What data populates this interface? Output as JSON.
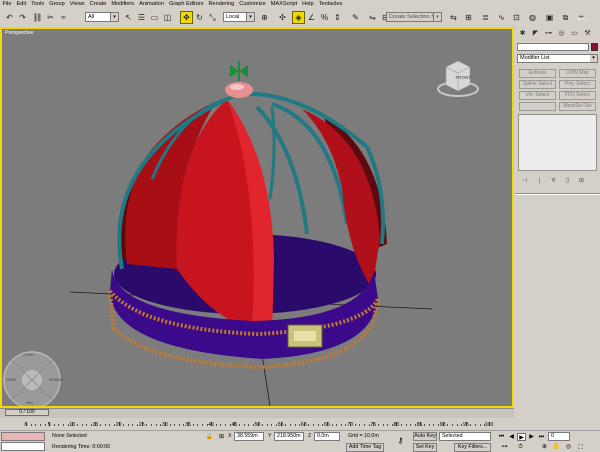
{
  "menu": [
    "File",
    "Edit",
    "Tools",
    "Group",
    "Views",
    "Create",
    "Modifiers",
    "Animation",
    "Graph Editors",
    "Rendering",
    "Customize",
    "MAXScript",
    "Help",
    "Tentacles"
  ],
  "toolbar": {
    "selection_filter": "All",
    "coord_system": "Local",
    "named_selection_placeholder": "Create Selection Set"
  },
  "viewport": {
    "label": "Perspective",
    "viewcube_label": "FRONT",
    "steering_wheel_labels": [
      "ZOOM",
      "ORBIT",
      "PAN",
      "REWIND",
      "CENTER",
      "WALK",
      "LOOK",
      "UP/DOWN"
    ],
    "colors": {
      "background": "#7c7c7c",
      "active_border": "#f2d900",
      "dome": "#c8141e",
      "frame": "#1f7a84",
      "band": "#3a0a8a",
      "beads": "#c47a2e"
    }
  },
  "command_panel": {
    "modifier_list": "Modifier List",
    "buttons": [
      "Extrude",
      "UVW Map",
      "Spline Select",
      "Poly Select",
      "Vol. Select",
      "FFD Select",
      "",
      "MeshSel Sel"
    ],
    "object_color": "#8e0c3a"
  },
  "timeline": {
    "slider_label": "0 / 100",
    "ticks": [
      0,
      5,
      10,
      15,
      20,
      25,
      30,
      35,
      40,
      45,
      50,
      55,
      60,
      65,
      70,
      75,
      80,
      85,
      90,
      95,
      100
    ]
  },
  "status": {
    "selection": "None Selected",
    "prompt": "Rendering Time: 0:00:00",
    "x_label": "X",
    "x_value": "38.559m",
    "y_label": "Y",
    "y_value": "218.950m",
    "z_label": "Z",
    "z_value": "0.0m",
    "grid": "Grid = 10.0m",
    "add_time_tag": "Add Time Tag",
    "auto_key": "Auto Key",
    "set_key": "Set Key",
    "key_mode": "Selected",
    "key_filters": "Key Filters...",
    "frame": "0"
  }
}
